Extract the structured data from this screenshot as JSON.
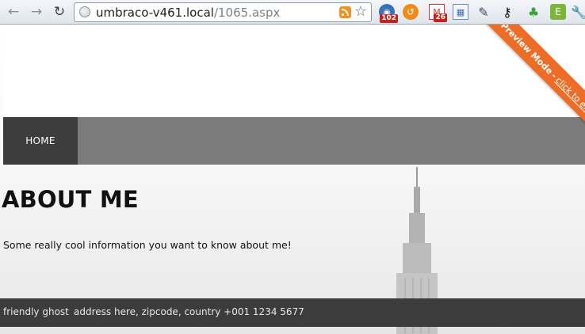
{
  "browser": {
    "nav": {
      "back_icon": "←",
      "forward_icon": "→",
      "reload_icon": "↻"
    },
    "url": {
      "host": "umbraco-v461.local",
      "path": "/1065.aspx"
    },
    "extensions": [
      {
        "name": "feed-reader-icon",
        "glyph": "◉",
        "badge": "102"
      },
      {
        "name": "orange-extension-icon",
        "glyph": "↺",
        "badge": ""
      },
      {
        "name": "gmail-icon",
        "glyph": "M",
        "badge": "26"
      },
      {
        "name": "calendar-icon",
        "glyph": "▦",
        "badge": ""
      },
      {
        "name": "eyedropper-icon",
        "glyph": "✎",
        "badge": ""
      },
      {
        "name": "key-icon",
        "glyph": "⚷",
        "badge": ""
      },
      {
        "name": "green-extension-icon",
        "glyph": "♣",
        "badge": ""
      },
      {
        "name": "evernote-icon",
        "glyph": "E",
        "badge": ""
      },
      {
        "name": "wrench-icon",
        "glyph": "🔧",
        "badge": ""
      }
    ]
  },
  "page": {
    "nav": {
      "home_label": "HOME"
    },
    "heading": "ABOUT ME",
    "body": "Some really cool information you want to know about me!",
    "footer": {
      "name": "friendly ghost",
      "address": "address here, zipcode, country +001 1234 5677"
    },
    "preview_ribbon": {
      "label": "Preview Mode",
      "separator": "-",
      "end_link": "click to end",
      "color": "#ee6d26"
    }
  },
  "colors": {
    "navbar": "#7b7b7b",
    "nav_active": "#3d3d3d",
    "footer": "#3c3c3c"
  }
}
